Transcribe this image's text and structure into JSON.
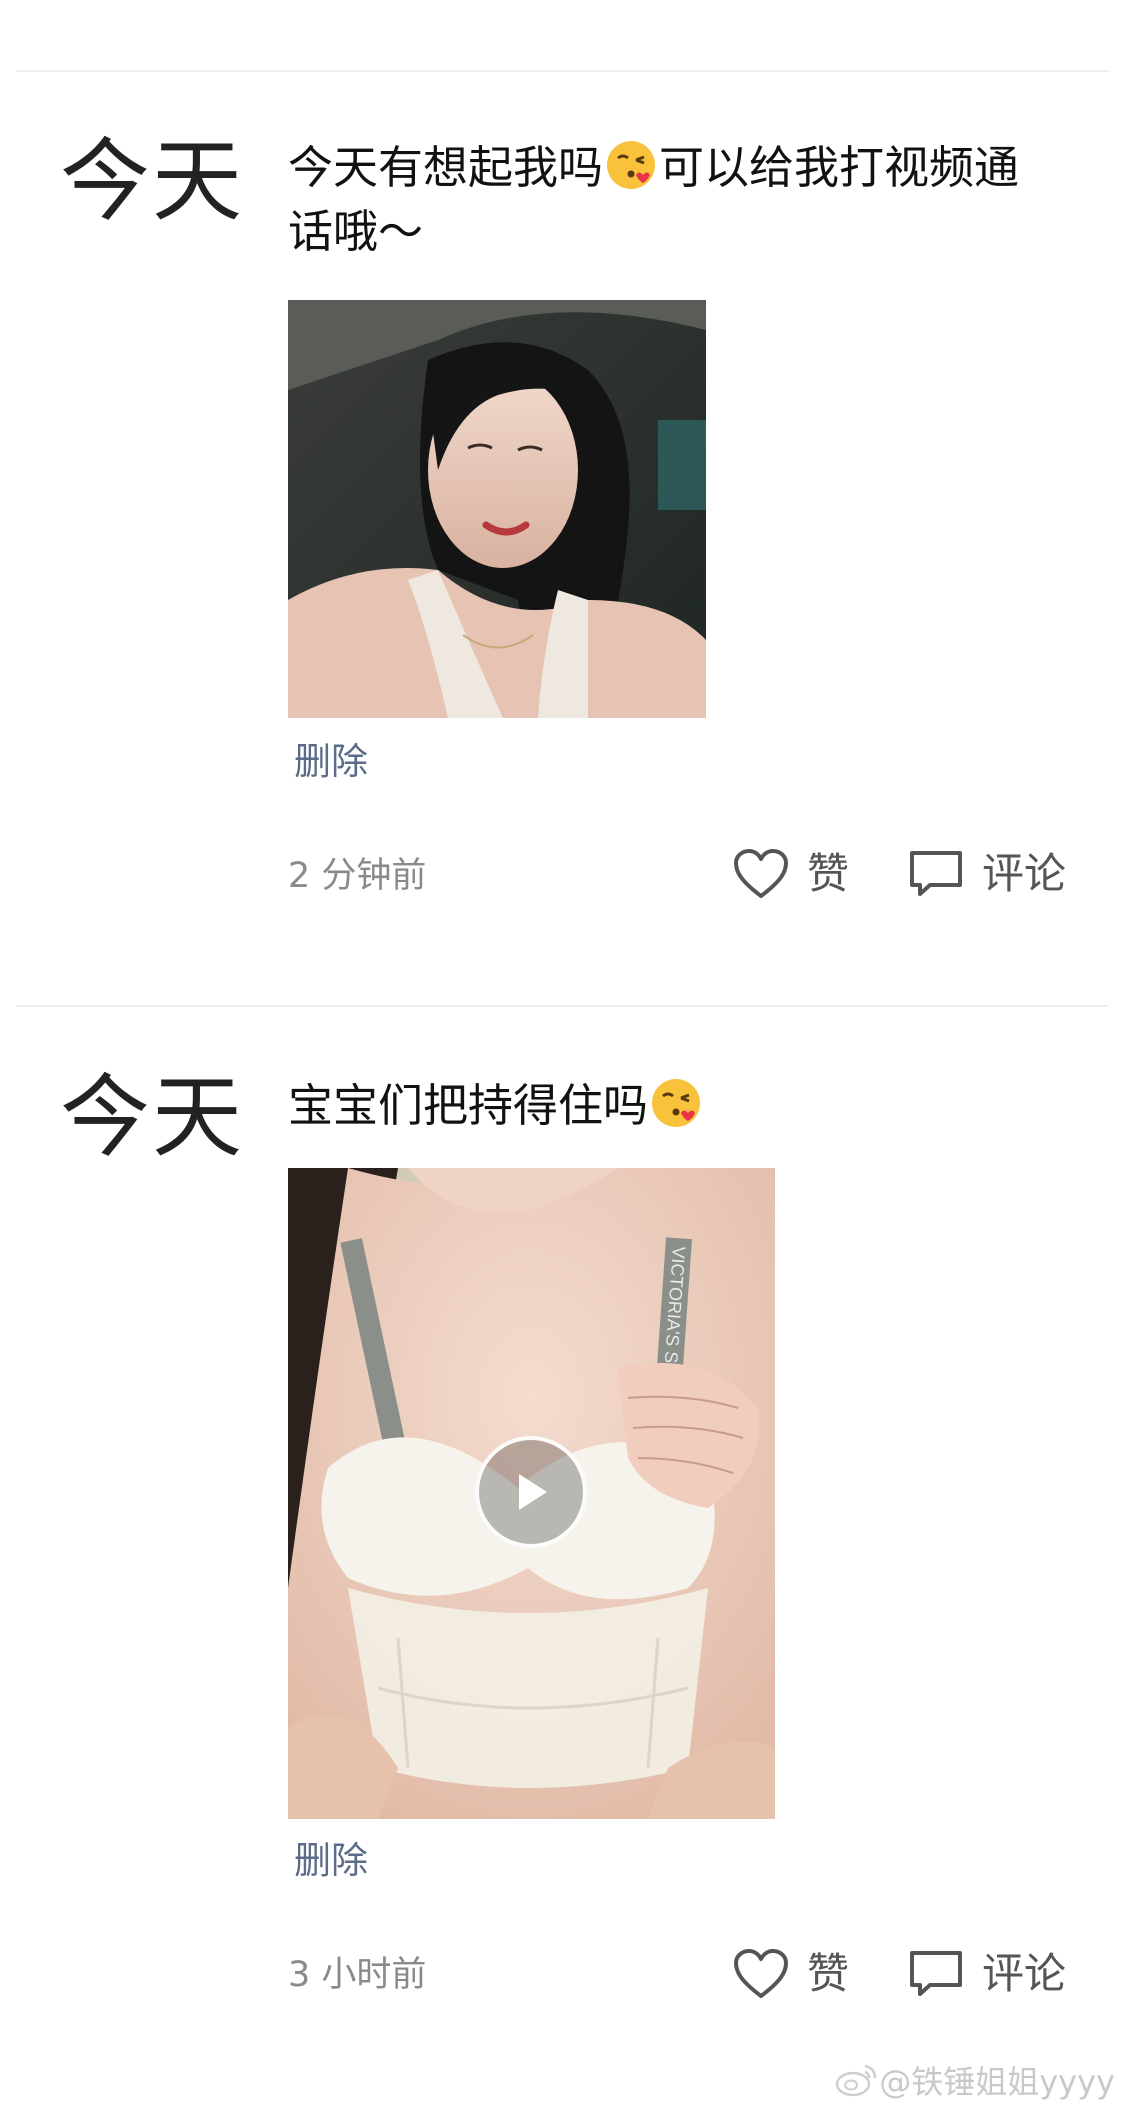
{
  "feed": {
    "posts": [
      {
        "day_label": "今天",
        "text_part1": "今天有想起我吗",
        "emoji": "kissing-face-emoji",
        "text_part2": "可以给我打视频通话哦～",
        "media_type": "photo",
        "delete_label": "删除",
        "timestamp": "2 分钟前",
        "like_label": "赞",
        "comment_label": "评论"
      },
      {
        "day_label": "今天",
        "text_part1": "宝宝们把持得住吗",
        "emoji": "kissing-face-emoji",
        "text_part2": "",
        "media_type": "video",
        "strap_text": "VICTORIA'S SECRET",
        "delete_label": "删除",
        "timestamp": "3 小时前",
        "like_label": "赞",
        "comment_label": "评论"
      }
    ]
  },
  "watermark": {
    "text": "@铁锤姐姐yyyy",
    "icon": "weibo-logo-icon"
  },
  "colors": {
    "link": "#5b6b88",
    "text": "#111111",
    "muted": "#8a8a8a",
    "divider": "#efefef"
  }
}
